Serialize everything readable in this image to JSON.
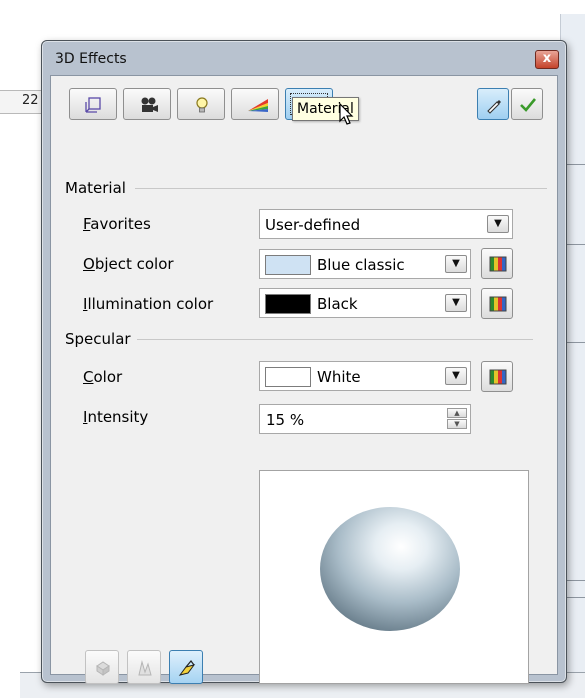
{
  "background": {
    "ruler_number": "22"
  },
  "dialog": {
    "title": "3D Effects",
    "close_glyph": "x",
    "toolbar": {
      "buttons": [
        {
          "name": "geometry",
          "icon": "geometry-icon"
        },
        {
          "name": "shading",
          "icon": "camera-icon"
        },
        {
          "name": "illumination",
          "icon": "lightbulb-icon"
        },
        {
          "name": "textures",
          "icon": "rainbow-icon"
        },
        {
          "name": "material",
          "icon": "material-icon",
          "active": true
        }
      ],
      "assign_icon": "pipette-icon",
      "apply_icon": "checkmark-icon"
    },
    "tooltip": "Material",
    "material": {
      "section_label": "Material",
      "favorites": {
        "label_u": "F",
        "label_rest": "avorites",
        "value": "User-defined"
      },
      "object_color": {
        "label_u": "O",
        "label_rest": "bject color",
        "value": "Blue classic",
        "swatch": "#cfe2f3"
      },
      "illumination_color": {
        "label_u": "I",
        "label_rest": "llumination color",
        "value": "Black",
        "swatch": "#000000"
      }
    },
    "specular": {
      "section_label": "Specular",
      "color": {
        "label_u": "C",
        "label_rest": "olor",
        "value": "White",
        "swatch": "#ffffff"
      },
      "intensity": {
        "label_u": "I",
        "label_rest": "ntensity",
        "value": "15 %"
      }
    },
    "bottom_buttons": [
      {
        "name": "convert-to-3d",
        "icon": "convert-3d-icon",
        "enabled": false
      },
      {
        "name": "convert-to-lathe",
        "icon": "lathe-icon",
        "enabled": false
      },
      {
        "name": "perspective",
        "icon": "perspective-icon",
        "enabled": true,
        "active": true
      }
    ]
  }
}
